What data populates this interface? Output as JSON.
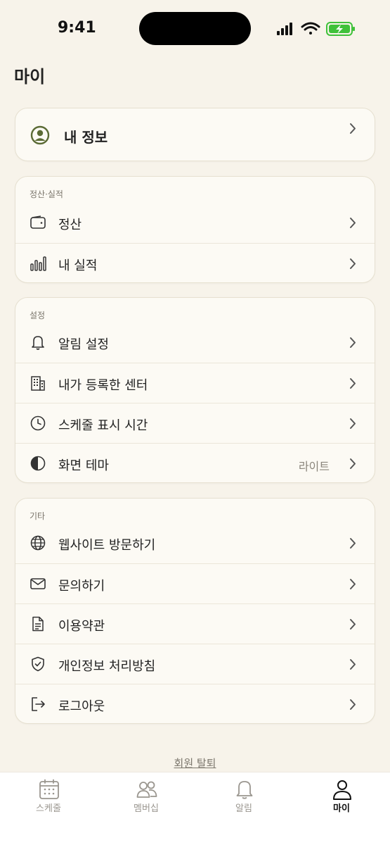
{
  "status_bar": {
    "time": "9:41"
  },
  "page": {
    "title": "마이"
  },
  "profile": {
    "label": "내 정보",
    "accent": "#5b6b35"
  },
  "sections": {
    "settlement": {
      "title": "정산·실적",
      "items": [
        {
          "label": "정산",
          "icon": "wallet-icon"
        },
        {
          "label": "내 실적",
          "icon": "bar-chart-icon"
        }
      ]
    },
    "settings": {
      "title": "설정",
      "items": [
        {
          "label": "알림 설정",
          "icon": "bell-icon"
        },
        {
          "label": "내가 등록한 센터",
          "icon": "building-icon"
        },
        {
          "label": "스케줄 표시 시간",
          "icon": "clock-icon"
        },
        {
          "label": "화면 테마",
          "icon": "contrast-icon",
          "value": "라이트"
        }
      ]
    },
    "etc": {
      "title": "기타",
      "items": [
        {
          "label": "웹사이트 방문하기",
          "icon": "globe-icon"
        },
        {
          "label": "문의하기",
          "icon": "mail-icon"
        },
        {
          "label": "이용약관",
          "icon": "document-icon"
        },
        {
          "label": "개인정보 처리방침",
          "icon": "shield-check-icon"
        },
        {
          "label": "로그아웃",
          "icon": "logout-icon"
        }
      ]
    }
  },
  "withdraw": {
    "label": "회원 탈퇴"
  },
  "tabbar": {
    "tabs": [
      {
        "label": "스케줄",
        "icon": "calendar-icon"
      },
      {
        "label": "멤버십",
        "icon": "members-icon"
      },
      {
        "label": "알림",
        "icon": "bell-icon"
      },
      {
        "label": "마이",
        "icon": "person-icon",
        "active": true
      }
    ]
  },
  "colors": {
    "background": "#f7f3ea",
    "card": "#fcfaf4",
    "battery_green": "#3fc13a"
  }
}
